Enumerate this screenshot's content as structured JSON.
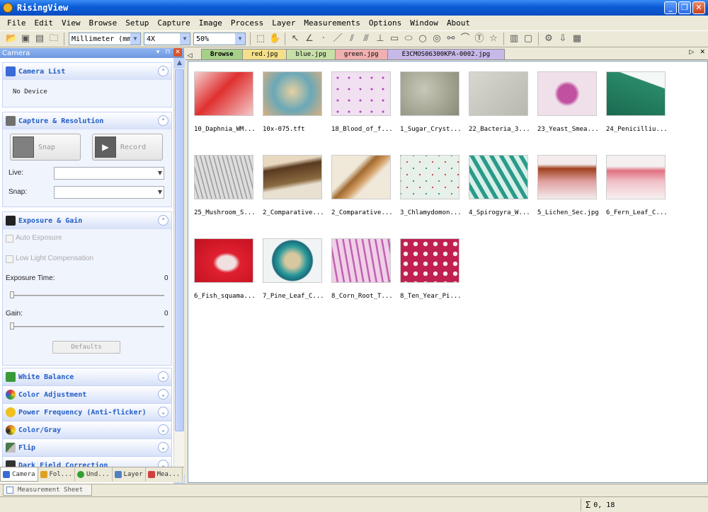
{
  "window": {
    "title": "RisingView"
  },
  "menu": [
    "File",
    "Edit",
    "View",
    "Browse",
    "Setup",
    "Capture",
    "Image",
    "Process",
    "Layer",
    "Measurements",
    "Options",
    "Window",
    "About"
  ],
  "toolbar": {
    "unit": "Millimeter (mm)",
    "magnification": "4X",
    "zoom": "50%"
  },
  "left_panel": {
    "title": "Camera",
    "camera_list": {
      "title": "Camera List",
      "status": "No Device"
    },
    "capture": {
      "title": "Capture & Resolution",
      "snap_label": "Snap",
      "record_label": "Record",
      "live_label": "Live:",
      "snap_res_label": "Snap:"
    },
    "exposure": {
      "title": "Exposure & Gain",
      "auto_exposure": "Auto Exposure",
      "low_light": "Low Light Compensation",
      "exposure_time_label": "Exposure Time:",
      "exposure_time_value": "0",
      "gain_label": "Gain:",
      "gain_value": "0",
      "defaults_label": "Defaults"
    },
    "collapsed_sections": [
      {
        "title": "White Balance",
        "icon": "white-balance-icon",
        "color": "#3a9a3a"
      },
      {
        "title": "Color Adjustment",
        "icon": "color-adjust-icon",
        "color": "#d04040"
      },
      {
        "title": "Power Frequency (Anti-flicker)",
        "icon": "bulb-icon",
        "color": "#f0c020"
      },
      {
        "title": "Color/Gray",
        "icon": "color-gray-icon",
        "color": "#e08020"
      },
      {
        "title": "Flip",
        "icon": "flip-icon",
        "color": "#4a7a4a"
      },
      {
        "title": "Dark Field Correction",
        "icon": "dark-field-icon",
        "color": "#333333"
      }
    ],
    "tabs": [
      "Camera",
      "Fol...",
      "Und...",
      "Layer",
      "Mea..."
    ]
  },
  "doc_tabs": [
    {
      "label": "Browse",
      "color": "#a6d08a"
    },
    {
      "label": "red.jpg",
      "color": "#f4e08a"
    },
    {
      "label": "blue.jpg",
      "color": "#c8e0a8"
    },
    {
      "label": "green.jpg",
      "color": "#f0b0b0"
    },
    {
      "label": "E3CMOS06300KPA-0002.jpg",
      "color": "#c8b8e8"
    }
  ],
  "thumbnails": [
    {
      "label": "10_Daphnia_WM...",
      "bg": "linear-gradient(135deg,#f4d0d0,#e03030 45%,#f4c8c8)"
    },
    {
      "label": "10x-075.tft",
      "bg": "radial-gradient(circle at 50% 45%,#e8d0a0,#6aa8b8 50%,#d8b080)"
    },
    {
      "label": "18_Blood_of_f...",
      "bg": "radial-gradient(circle,#b040c0 12%,#f0e0f0 14%) 0 0/16px 16px"
    },
    {
      "label": "1_Sugar_Cryst...",
      "bg": "radial-gradient(circle at 40% 40%,#c8c8b8,#8a8a78)"
    },
    {
      "label": "22_Bacteria_3...",
      "bg": "linear-gradient(135deg,#d8d8d0,#b8b8b0)"
    },
    {
      "label": "23_Yeast_Smea...",
      "bg": "radial-gradient(circle at 50% 50%,#c050a0 25%,#f0e0ea 35%)"
    },
    {
      "label": "24_Penicilliu...",
      "bg": "linear-gradient(200deg,#f4f8f6 25%,#2a8a6a 26%,#1a6a50)"
    },
    {
      "label": "25_Mushroom_S...",
      "bg": "repeating-linear-gradient(75deg,#ddd 0 4px,#999 5px 6px)"
    },
    {
      "label": "2_Comparative...",
      "bg": "linear-gradient(170deg,#e8d8c0 20%,#5a3a20 30%,#8a6a40 60%,#e8e0d0 70%)"
    },
    {
      "label": "2_Comparative...",
      "bg": "linear-gradient(135deg,#f0e8d8 35%,#a06a30 45%,#d09a60 55%,#f0e8d8 65%)"
    },
    {
      "label": "3_Chlamydomon...",
      "bg": "radial-gradient(circle,#d04040 8%,transparent 10%) 0 0/18px 18px, radial-gradient(circle,#2a9a6a 8%,#e8f0ea 10%) 9px 9px/18px 18px"
    },
    {
      "label": "4_Spirogyra_W...",
      "bg": "repeating-linear-gradient(60deg,#d8f0e8 0 6px,#2a9a8a 7px 12px)"
    },
    {
      "label": "5_Lichen_Sec.jpg",
      "bg": "linear-gradient(180deg,#f4ecec 20%,#a04020 30%,#e0a0a0 60%,#f4ecec)"
    },
    {
      "label": "6_Fern_Leaf_C...",
      "bg": "linear-gradient(180deg,#f4f0f0 25%,#e07080 35%,#f0c0c8 60%,#f8f0f0)"
    },
    {
      "label": "6_Fish_squama...",
      "bg": "radial-gradient(ellipse at 55% 55%,#f0e0e0 20%,#e02030 30%,#c01020)"
    },
    {
      "label": "7_Pine_Leaf_C...",
      "bg": "radial-gradient(circle at 50% 50%,#d8c8a0 20%,#2a9a9a 40%,#1a6a7a 55%,#f0f4f4 58%)"
    },
    {
      "label": "8_Corn_Root_T...",
      "bg": "repeating-linear-gradient(80deg,#f0d0e8 0 6px,#c060b0 7px 9px)"
    },
    {
      "label": "8_Ten_Year_Pi...",
      "bg": "radial-gradient(circle,#f4e8ec 30%,#c02050 34%) 0 0/14px 14px"
    }
  ],
  "bottom": {
    "measurement_sheet": "Measurement Sheet",
    "status": "0, 18"
  }
}
